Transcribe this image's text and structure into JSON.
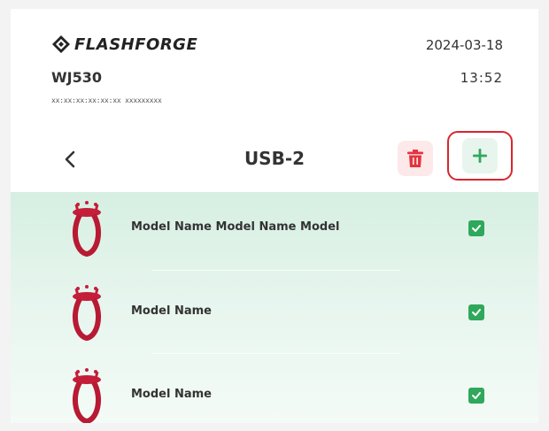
{
  "header": {
    "brand": "FLASHFORGE",
    "device_name": "WJ530",
    "device_id": "xx:xx:xx:xx:xx:xx  xxxxxxxxx",
    "date": "2024-03-18",
    "time": "13:52"
  },
  "toolbar": {
    "back_icon": "chevron-left-icon",
    "title": "USB-2",
    "delete_icon": "trash-icon",
    "add_icon": "plus-icon"
  },
  "files": [
    {
      "name": "Model Name Model Name Model",
      "selected": true
    },
    {
      "name": "Model Name",
      "selected": true
    },
    {
      "name": "Model Name",
      "selected": true
    }
  ],
  "colors": {
    "accent_green": "#2fa85b",
    "delete_red": "#e4343e",
    "highlight_border": "#d8262e",
    "list_background": "#dff2e8"
  }
}
